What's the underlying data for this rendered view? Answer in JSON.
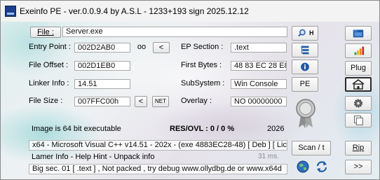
{
  "window": {
    "title": "Exeinfo PE - ver.0.0.9.4  by A.S.L -  1233+193 sign  2025.12.12"
  },
  "file": {
    "button_label": "File :",
    "value": "Server.exe"
  },
  "entry_point": {
    "label": "Entry Point :",
    "value": "002D2AB0",
    "oo_label": "oo",
    "arrow_label": "<"
  },
  "ep_section": {
    "label": "EP Section :",
    "value": ".text"
  },
  "file_offset": {
    "label": "File Offset :",
    "value": "002D1EB0"
  },
  "first_bytes": {
    "label": "First Bytes :",
    "value": "48 83 EC 28 E8"
  },
  "linker_info": {
    "label": "Linker Info :",
    "value": "14.51"
  },
  "subsystem": {
    "label": "SubSystem :",
    "value": "Win Console"
  },
  "file_size": {
    "label": "File Size :",
    "value": "007FFC00h",
    "arrow_label": "<",
    "net_label": "NET"
  },
  "overlay": {
    "label": "Overlay :",
    "value": "NO  00000000"
  },
  "image_info": "Image is 64 bit executable",
  "res_ovl": "RES/OVL : 0 / 0 %",
  "year": "2026",
  "detection": "x64 - Microsoft Visual C++ v14.51 - 202x - (exe 4883EC28-48) [ Deb ] [ Lic",
  "lamer_info": "Lamer Info - Help Hint - Unpack info",
  "time_ms": "31 ms.",
  "big_sec": "Big sec. 01 [ .text ] , Not packed , try debug www.ollydbg.de or www.x64d",
  "middle_buttons": {
    "search_h": "H",
    "pe": "PE",
    "scan": "Scan / t"
  },
  "right_buttons": {
    "plug": "Plug",
    "rip": "Rip",
    "next": ">>"
  },
  "icons": [
    "app-icon",
    "search-icon",
    "tree-icon",
    "info-icon",
    "award-seal-icon",
    "folder-icon",
    "bars-icon",
    "home-icon",
    "gear-icon",
    "copy-icon",
    "globe-icon",
    "refresh-icon"
  ],
  "colors": {
    "accent_blue": "#1e5aa8",
    "bar_green": "#2a9d3a",
    "bar_orange": "#e08a1a",
    "bar_red": "#cc2a2a"
  }
}
